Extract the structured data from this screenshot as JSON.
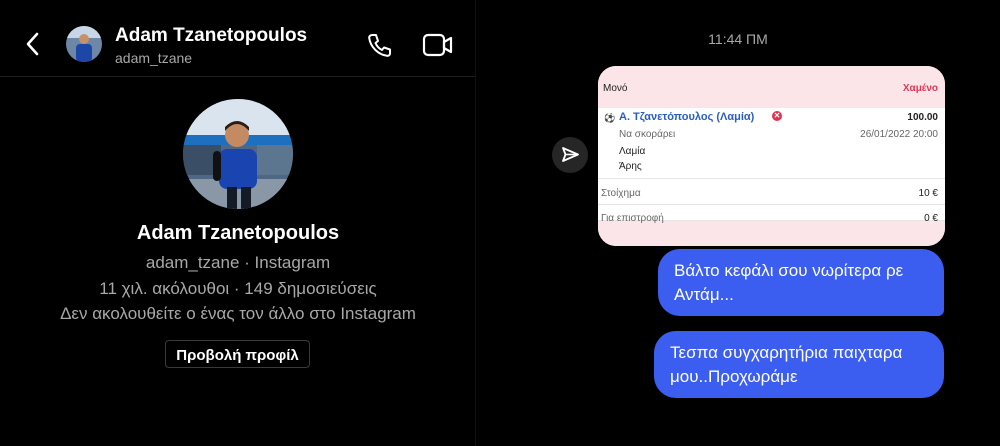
{
  "header": {
    "name": "Adam Tzanetopoulos",
    "username": "adam_tzane"
  },
  "profile": {
    "name": "Adam Tzanetopoulos",
    "subtitle": "adam_tzane · Instagram",
    "stats": "11 χιλ. ακόλουθοι · 149 δημοσιεύσεις",
    "relation": "Δεν ακολουθείτε ο ένας τον άλλο στο Instagram",
    "view_button": "Προβολή προφίλ"
  },
  "chat": {
    "timestamp": "11:44 ΠΜ",
    "bet_card": {
      "type_label": "Μονό",
      "status_label": "Χαμένο",
      "player": "Α. Τζανετόπουλος (Λαμία)",
      "odds_amount": "100.00",
      "market": "Να σκοράρει",
      "datetime": "26/01/2022 20:00",
      "team_home": "Λαμία",
      "team_away": "Άρης",
      "stake_label": "Στοίχημα",
      "stake_value": "10 €",
      "return_label": "Για επιστροφή",
      "return_value": "0 €"
    },
    "messages": [
      {
        "text": "Βάλτο κεφάλι σου νωρίτερα ρε Αντάμ..."
      },
      {
        "text": "Τεσπα συγχαρητήρια παιχταρα μου..Προχωράμε"
      }
    ]
  },
  "colors": {
    "bubble": "#3c5ef0",
    "lost": "#d63b55",
    "player_link": "#2a5fc1"
  },
  "icons": [
    "back-arrow-icon",
    "phone-icon",
    "video-camera-icon",
    "send-icon",
    "soccer-ball-icon",
    "close-circle-icon"
  ]
}
